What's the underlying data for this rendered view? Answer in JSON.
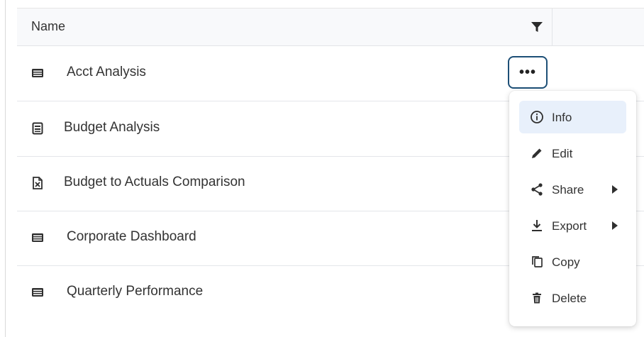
{
  "table": {
    "column_name": "Name",
    "rows": [
      {
        "label": "Acct Analysis",
        "icon": "dashboard-icon"
      },
      {
        "label": "Budget Analysis",
        "icon": "report-icon"
      },
      {
        "label": "Budget to Actuals Comparison",
        "icon": "excel-file-icon"
      },
      {
        "label": "Corporate Dashboard",
        "icon": "dashboard-icon"
      },
      {
        "label": "Quarterly Performance",
        "icon": "dashboard-icon"
      }
    ],
    "more_button_label": "•••"
  },
  "context_menu": {
    "items": [
      {
        "label": "Info",
        "icon": "info-icon",
        "active": true
      },
      {
        "label": "Edit",
        "icon": "pencil-icon"
      },
      {
        "label": "Share",
        "icon": "share-icon",
        "submenu": true
      },
      {
        "label": "Export",
        "icon": "download-icon",
        "submenu": true
      },
      {
        "label": "Copy",
        "icon": "copy-icon"
      },
      {
        "label": "Delete",
        "icon": "trash-icon"
      }
    ]
  },
  "colors": {
    "accent_border": "#1d4f76",
    "menu_active_bg": "#e8f0fb",
    "header_bg": "#f8f9fb"
  }
}
